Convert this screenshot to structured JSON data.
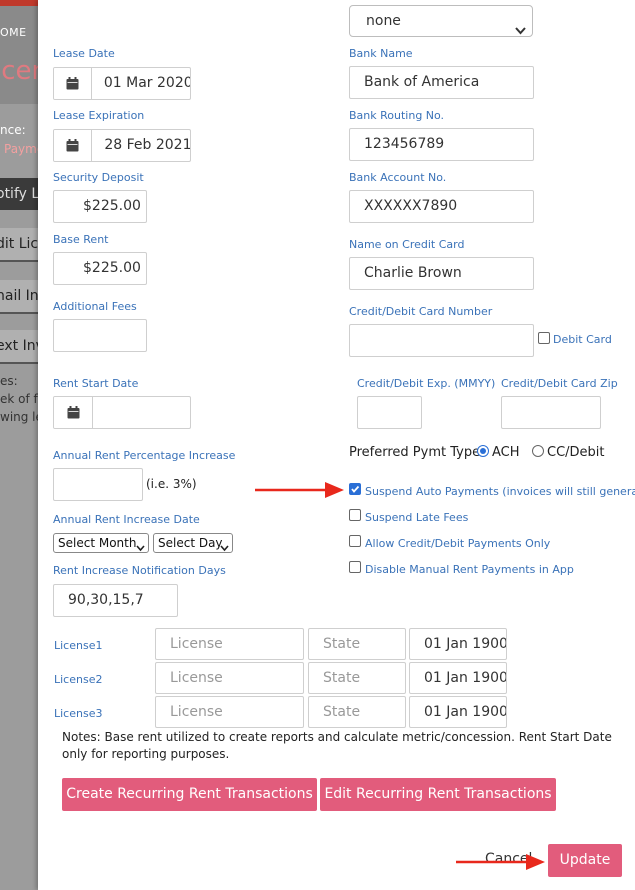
{
  "background_page": {
    "breadcrumb": "OME",
    "title": "icen",
    "line1": "nce:",
    "line2": "Payme",
    "btn_notify": "otify L",
    "btn_edit": "dit Lice",
    "btn_email": "nail In",
    "btn_text": "ext Inv",
    "note1": "es:",
    "note2": "ek of fr",
    "note3": "wing le"
  },
  "form": {
    "top_select": "none",
    "lease_date": {
      "label": "Lease Date",
      "value": "01 Mar 2020"
    },
    "lease_expiration": {
      "label": "Lease Expiration",
      "value": "28 Feb 2021"
    },
    "security_deposit": {
      "label": "Security Deposit",
      "value": "$225.00"
    },
    "base_rent": {
      "label": "Base Rent",
      "value": "$225.00"
    },
    "additional_fees": {
      "label": "Additional Fees",
      "value": ""
    },
    "rent_start_date": {
      "label": "Rent Start Date",
      "value": ""
    },
    "annual_increase": {
      "label": "Annual Rent Percentage Increase",
      "value": "",
      "hint": "(i.e. 3%)"
    },
    "increase_date": {
      "label": "Annual Rent Increase Date",
      "month": "Select Month",
      "day": "Select Day"
    },
    "notification_days": {
      "label": "Rent Increase Notification Days",
      "value": "90,30,15,7"
    },
    "bank_name": {
      "label": "Bank Name",
      "value": "Bank of America"
    },
    "routing": {
      "label": "Bank Routing No.",
      "value": "123456789"
    },
    "account": {
      "label": "Bank Account No.",
      "value": "XXXXXX7890"
    },
    "name_on_card": {
      "label": "Name on Credit Card",
      "value": "Charlie Brown"
    },
    "card_number": {
      "label": "Credit/Debit Card Number",
      "value": "",
      "debit_label": "Debit Card"
    },
    "card_exp": {
      "label": "Credit/Debit Exp. (MMYY)",
      "value": ""
    },
    "card_zip": {
      "label": "Credit/Debit Card Zip",
      "value": ""
    },
    "pymt_type": {
      "label": "Preferred Pymt Type",
      "option1": "ACH",
      "option2": "CC/Debit",
      "selected": "ACH"
    },
    "options": {
      "suspend_auto": "Suspend Auto Payments (invoices will still generate)",
      "suspend_late": "Suspend Late Fees",
      "allow_credit": "Allow Credit/Debit Payments Only",
      "disable_manual": "Disable Manual Rent Payments in App",
      "suspend_auto_checked": true
    },
    "licenses": [
      {
        "label": "License1",
        "license_ph": "License",
        "state_ph": "State",
        "date": "01 Jan 1900"
      },
      {
        "label": "License2",
        "license_ph": "License",
        "state_ph": "State",
        "date": "01 Jan 1900"
      },
      {
        "label": "License3",
        "license_ph": "License",
        "state_ph": "State",
        "date": "01 Jan 1900"
      }
    ],
    "notes": "Notes: Base rent utilized to create reports and calculate metric/concession. Rent Start Date only for reporting purposes.",
    "create_btn": "Create Recurring Rent Transactions",
    "edit_btn": "Edit Recurring Rent Transactions",
    "cancel_btn": "Cancel",
    "update_btn": "Update"
  },
  "colors": {
    "accent": "#e25c7c",
    "label_blue": "#3a72b8",
    "arrow_red": "#e8281c"
  }
}
